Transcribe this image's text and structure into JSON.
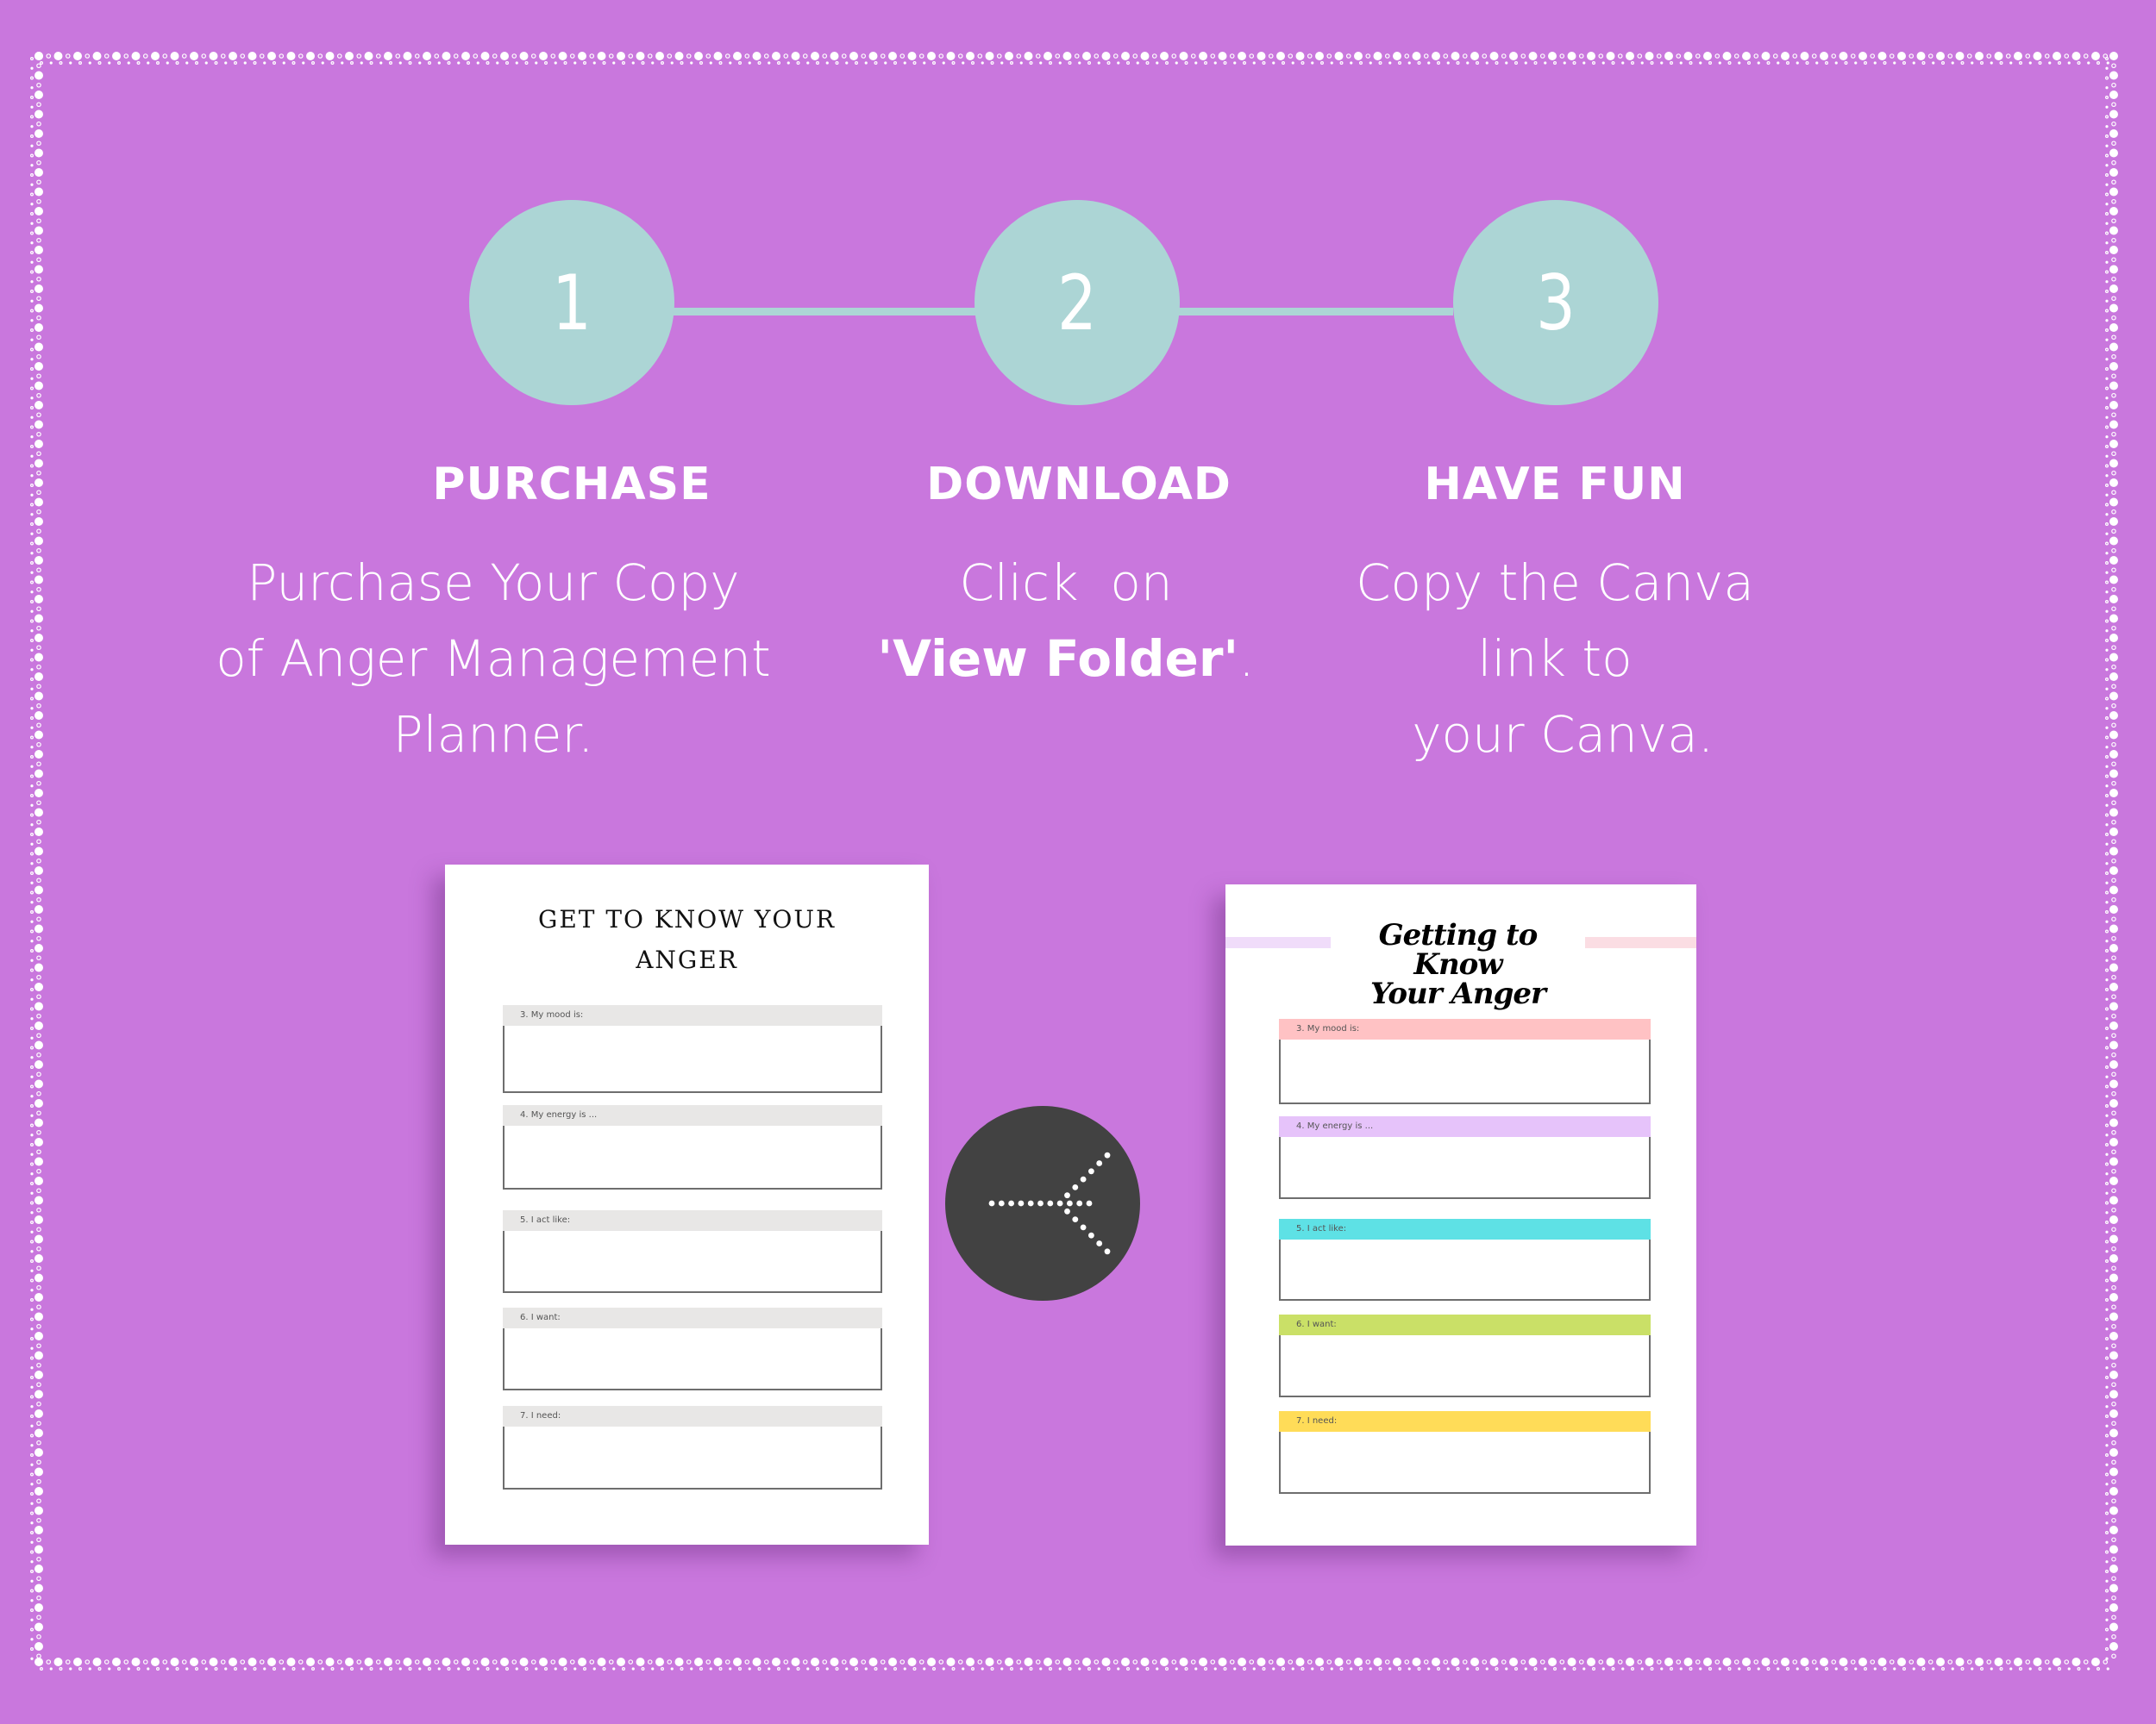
{
  "colors": {
    "background": "#C977DD",
    "step_circle": "#ACD5D5",
    "arrow_button": "#424242",
    "header_gray": "#E8E7E6",
    "header_pink": "#FFC2C4",
    "header_lavender": "#E6C3FA",
    "header_cyan": "#5EE1E5",
    "header_green": "#CAE067",
    "header_yellow": "#FFDC58"
  },
  "steps": [
    {
      "number": "1",
      "title": "PURCHASE",
      "description_lines": [
        "Purchase Your Copy",
        "of Anger Management",
        "Planner."
      ]
    },
    {
      "number": "2",
      "title": "DOWNLOAD",
      "description_line1": "Click  on",
      "description_bold": "'View Folder'",
      "description_suffix": "."
    },
    {
      "number": "3",
      "title": "HAVE FUN",
      "description_lines": [
        "Copy the Canva",
        "link to",
        " your Canva."
      ]
    }
  ],
  "preview_before": {
    "title_lines": [
      "GET TO KNOW YOUR",
      "ANGER"
    ],
    "fields": [
      "3. My mood is:",
      "4. My energy is ...",
      "5. I act like:",
      "6. I want:",
      "7. I need:"
    ]
  },
  "arrow": {
    "icon": "dotted-arrow-right-icon"
  },
  "preview_after": {
    "title_lines": [
      "Getting to Know",
      "Your Anger"
    ],
    "fields": [
      "3. My mood is:",
      "4. My energy is ...",
      "5. I act like:",
      "6. I want:",
      "7. I need:"
    ]
  }
}
